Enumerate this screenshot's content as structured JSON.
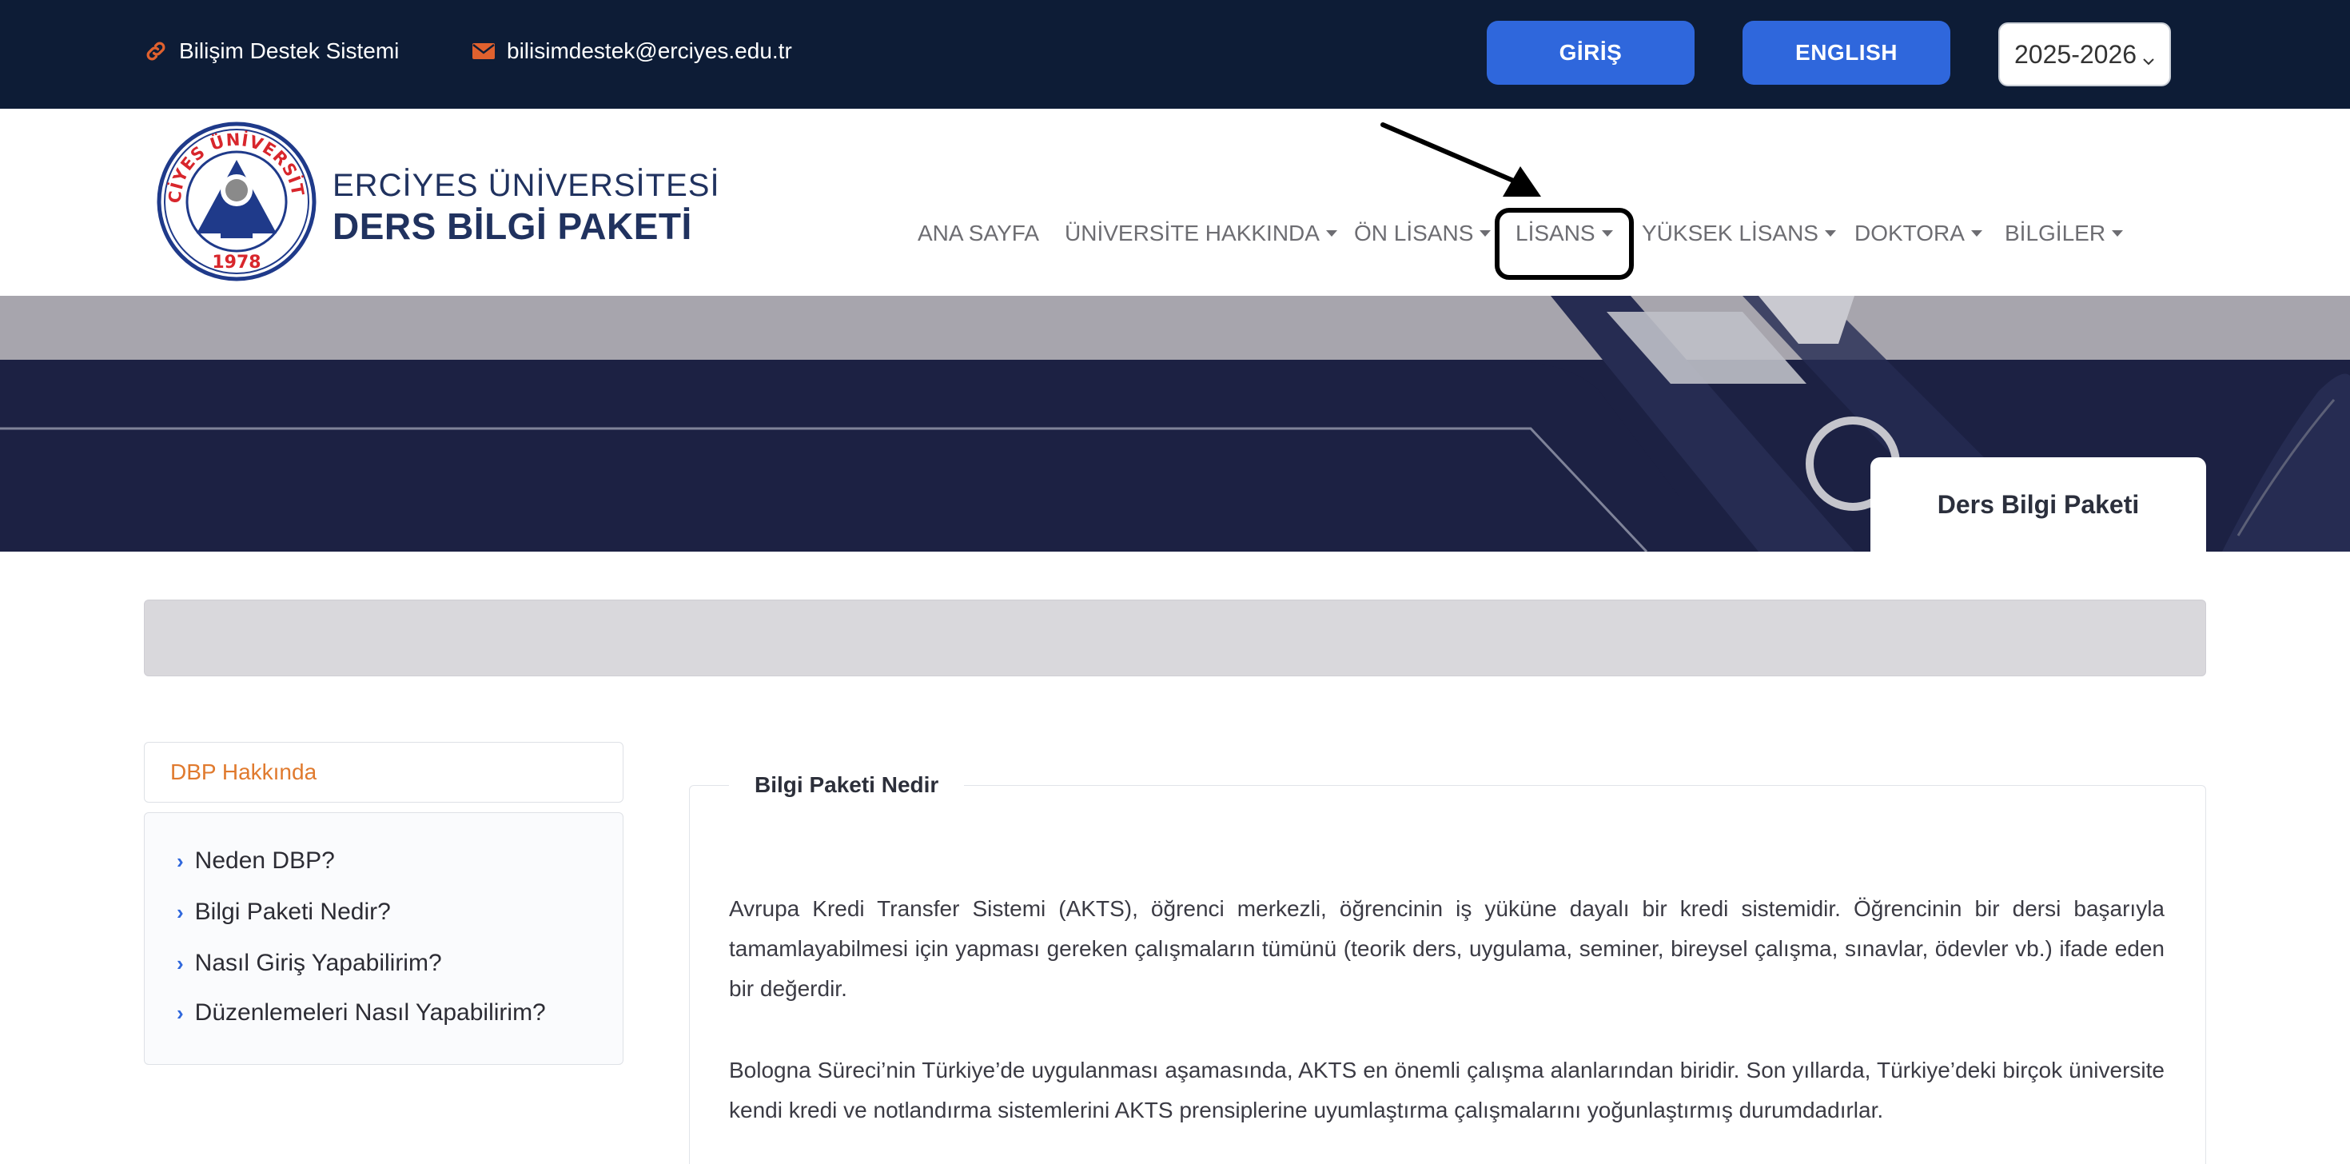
{
  "topbar": {
    "support_label": "Bilişim Destek Sistemi",
    "email": "bilisimdestek@erciyes.edu.tr",
    "login_label": "GİRİŞ",
    "english_label": "ENGLISH",
    "year_selected": "2025-2026",
    "icons": {
      "support": "link-icon",
      "email": "envelope-icon"
    },
    "colors": {
      "bar": "#0d1c36",
      "button": "#2f67dc",
      "icon_accent": "#e0612e"
    }
  },
  "brand": {
    "line1": "ERCİYES ÜNİVERSİTESİ",
    "line2": "DERS BİLGİ PAKETİ",
    "seal_text": "ERCİYES ÜNİVERSİTESİ",
    "seal_year": "1978"
  },
  "nav": {
    "items": [
      {
        "label": "ANA SAYFA",
        "dropdown": false
      },
      {
        "label": "ÜNİVERSİTE HAKKINDA",
        "dropdown": true
      },
      {
        "label": "ÖN LİSANS",
        "dropdown": true
      },
      {
        "label": "LİSANS",
        "dropdown": true
      },
      {
        "label": "YÜKSEK LİSANS",
        "dropdown": true
      },
      {
        "label": "DOKTORA",
        "dropdown": true
      },
      {
        "label": "BİLGİLER",
        "dropdown": true
      }
    ]
  },
  "hero": {
    "card_title": "Ders Bilgi Paketi"
  },
  "sidebar": {
    "title": "DBP Hakkında",
    "items": [
      {
        "label": "Neden DBP?"
      },
      {
        "label": "Bilgi Paketi Nedir?"
      },
      {
        "label": "Nasıl Giriş Yapabilirim?"
      },
      {
        "label": "Düzenlemeleri Nasıl Yapabilirim?"
      }
    ]
  },
  "content": {
    "title": "Bilgi Paketi Nedir",
    "paragraphs": [
      "Avrupa Kredi Transfer Sistemi (AKTS), öğrenci merkezli, öğrencinin iş yüküne dayalı bir kredi sistemidir. Öğrencinin bir dersi başarıyla tamamlayabilmesi için yapması gereken çalışmaların tümünü (teorik ders, uygulama, seminer, bireysel çalışma, sınavlar, ödevler vb.) ifade eden bir değerdir.",
      "Bologna Süreci’nin Türkiye’de uygulanması aşamasında, AKTS en önemli çalışma alanlarından biridir. Son yıllarda, Türkiye’deki birçok üniversite kendi kredi ve notlandırma sistemlerini AKTS prensiplerine uyumlaştırma çalışmalarını yoğunlaştırmış durumdadırlar."
    ]
  }
}
